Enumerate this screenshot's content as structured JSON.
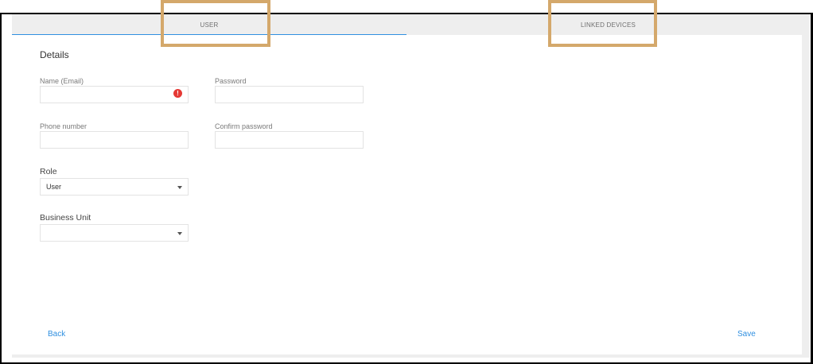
{
  "tabs": {
    "user": "USER",
    "linked_devices": "LINKED DEVICES"
  },
  "details": {
    "title": "Details",
    "name_email_label": "Name (Email)",
    "password_label": "Password",
    "phone_label": "Phone number",
    "confirm_password_label": "Confirm password",
    "role_label": "Role",
    "role_value": "User",
    "business_unit_label": "Business Unit",
    "business_unit_value": "",
    "name_email_value": "",
    "password_value": "",
    "phone_value": "",
    "confirm_password_value": ""
  },
  "actions": {
    "back": "Back",
    "save": "Save"
  },
  "icons": {
    "error": "error-icon",
    "dropdown": "chevron-down-icon"
  },
  "colors": {
    "accent": "#2f8fe0",
    "error": "#e53935",
    "highlight": "#d4a86b"
  }
}
